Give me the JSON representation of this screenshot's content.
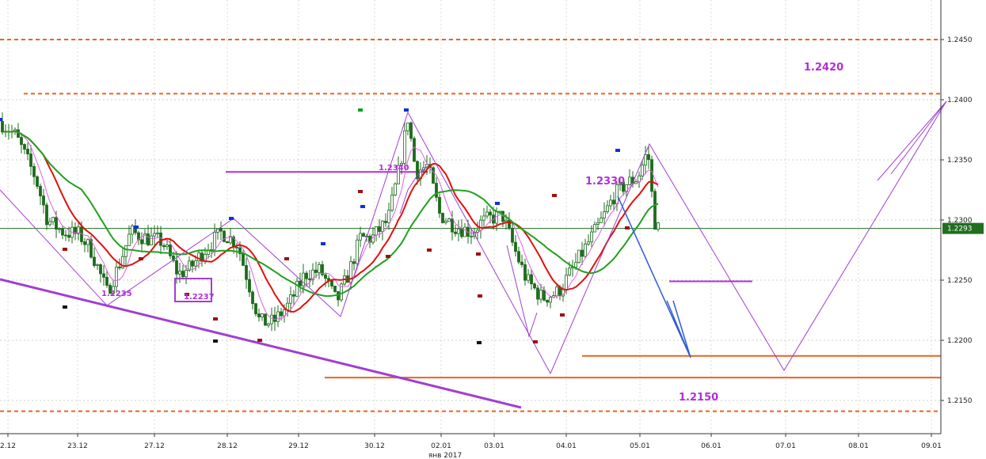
{
  "chart_data": {
    "type": "candlestick",
    "symbol_price_badge": "1.2293",
    "y_ticks": [
      "1.2450",
      "1.2400",
      "1.2350",
      "1.2300",
      "1.2250",
      "1.2200",
      "1.2150"
    ],
    "ylim": [
      1.2117,
      1.248
    ],
    "x_ticks": [
      "2.12",
      "23.12",
      "27.12",
      "28.12",
      "29.12",
      "30.12",
      "02.01",
      "03.01",
      "04.01",
      "05.01",
      "06.01",
      "07.01",
      "08.01",
      "09.01"
    ],
    "x_sublabel": "янв 2017",
    "current_price": 1.2293,
    "levels": [
      {
        "kind": "dashed",
        "value": 1.245,
        "color": "#e8641e"
      },
      {
        "kind": "dashed",
        "value": 1.2405,
        "color": "#e8641e"
      },
      {
        "kind": "dashed",
        "value": 1.2141,
        "color": "#e8641e"
      },
      {
        "kind": "solid",
        "value": 1.2187,
        "color": "#e8641e"
      },
      {
        "kind": "solid",
        "value": 1.2169,
        "color": "#e8641e"
      },
      {
        "kind": "solid",
        "value": 1.234,
        "color": "#b22fd6"
      },
      {
        "kind": "solid",
        "value": 1.2249,
        "color": "#b22fd6"
      }
    ],
    "annotations": [
      {
        "text": "1.2420",
        "size": "large"
      },
      {
        "text": "1.2340",
        "size": "small"
      },
      {
        "text": "1.2330",
        "size": "large"
      },
      {
        "text": "1.2235",
        "size": "small"
      },
      {
        "text": "1.2237",
        "size": "small"
      },
      {
        "text": "1.2150",
        "size": "large"
      }
    ],
    "colors": {
      "background": "#ffffff",
      "candles": "#1c6b1c",
      "ma_red": "#e01010",
      "ma_green": "#20a020",
      "ma_magenta": "#e060e0",
      "zigzag": "#a13fd0",
      "price_badge": "#1f6f1f"
    }
  }
}
